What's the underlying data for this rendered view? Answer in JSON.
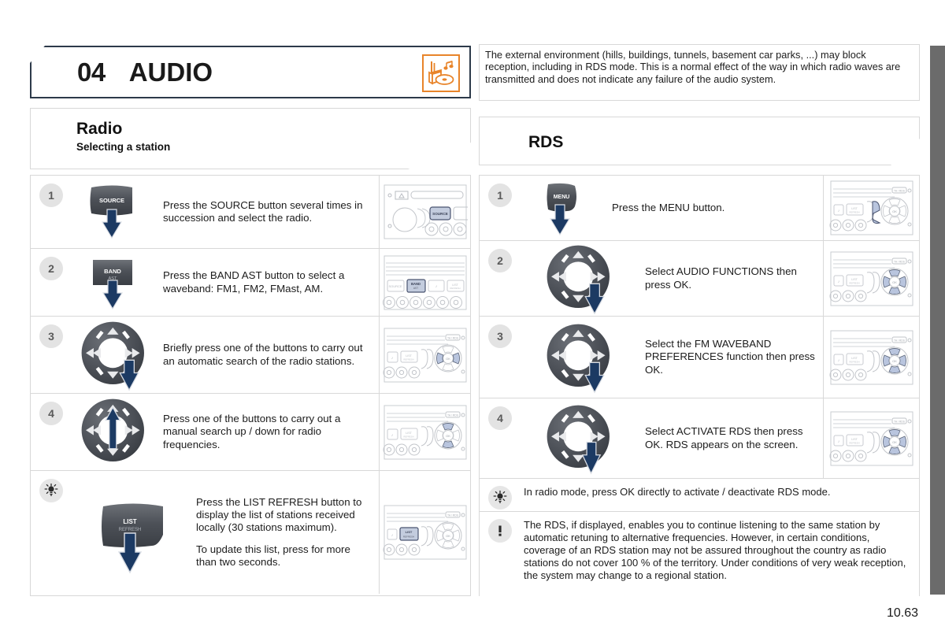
{
  "chapter": {
    "number": "04",
    "title": "AUDIO",
    "icon": "audio-system-icon"
  },
  "top_note": {
    "text": "The external environment (hills, buildings, tunnels, basement car parks, ...) may block reception, including in RDS mode. This is a normal effect of the way in which radio waves are transmitted and does not indicate any failure of the audio system."
  },
  "left_section": {
    "title": "Radio",
    "subtitle": "Selecting a station",
    "steps": [
      {
        "badge": "1",
        "control": "source-button",
        "control_label_top": "SOURCE",
        "control_label_bottom": "",
        "text": [
          "Press the SOURCE button several times in succession and select the radio."
        ],
        "unit_image": "radio-unit-source-highlight"
      },
      {
        "badge": "2",
        "control": "band-ast-button",
        "control_label_top": "BAND",
        "control_label_bottom": "AST",
        "text": [
          "Press the BAND AST button to select a waveband: FM1, FM2, FMast, AM."
        ],
        "unit_image": "radio-unit-band-highlight"
      },
      {
        "badge": "3",
        "control": "dpad-right",
        "control_label_top": "",
        "control_label_bottom": "",
        "text": [
          "Briefly press one of the buttons to carry out an automatic search of the radio stations."
        ],
        "unit_image": "radio-unit-dpad-leftright-highlight"
      },
      {
        "badge": "4",
        "control": "dpad-up",
        "control_label_top": "",
        "control_label_bottom": "",
        "text": [
          "Press one of the buttons to carry out a manual search up / down for radio frequencies."
        ],
        "unit_image": "radio-unit-dpad-updown-highlight"
      },
      {
        "badge": "tip",
        "control": "list-refresh-button",
        "control_label_top": "LIST",
        "control_label_bottom": "REFRESH",
        "text": [
          "Press the LIST REFRESH button to display the list of stations received locally (30 stations maximum).",
          "To update this list, press for more than two seconds."
        ],
        "unit_image": "radio-unit-list-highlight"
      }
    ]
  },
  "right_section": {
    "title": "RDS",
    "subtitle": "",
    "steps": [
      {
        "badge": "1",
        "control": "menu-button",
        "control_label_top": "MENU",
        "control_label_bottom": "",
        "text": [
          "Press the MENU button."
        ],
        "unit_image": "radio-unit-menu-highlight"
      },
      {
        "badge": "2",
        "control": "dpad-right",
        "control_label_top": "",
        "control_label_bottom": "",
        "text": [
          "Select AUDIO FUNCTIONS then press OK."
        ],
        "unit_image": "radio-unit-dpad-all-highlight"
      },
      {
        "badge": "3",
        "control": "dpad-right",
        "control_label_top": "",
        "control_label_bottom": "",
        "text": [
          "Select the FM WAVEBAND PREFERENCES function then press OK."
        ],
        "unit_image": "radio-unit-dpad-all-highlight"
      },
      {
        "badge": "4",
        "control": "dpad-right",
        "control_label_top": "",
        "control_label_bottom": "",
        "text": [
          "Select ACTIVATE RDS then press OK. RDS appears on the screen."
        ],
        "unit_image": "radio-unit-dpad-all-highlight"
      }
    ],
    "notes": [
      {
        "badge": "tip",
        "text": [
          "In radio mode, press OK directly to activate / deactivate RDS mode."
        ]
      },
      {
        "badge": "warning",
        "text": [
          "The RDS, if displayed, enables you to continue listening to the same station by automatic retuning to alternative frequencies. However, in certain conditions, coverage of an RDS station may not be assured throughout the country as radio stations do not cover 100 % of the territory. Under conditions of very weak reception, the system may change to a regional station."
        ]
      }
    ]
  },
  "footer": {
    "page_number": "10.63"
  },
  "colors": {
    "accent_orange": "#e8842a",
    "header_border": "#2d3a4a",
    "arrow_blue": "#1c3a63",
    "panel_border": "#d8d8d8",
    "edge_tab": "#6b6b6b",
    "badge_bg": "#e3e3e3"
  }
}
